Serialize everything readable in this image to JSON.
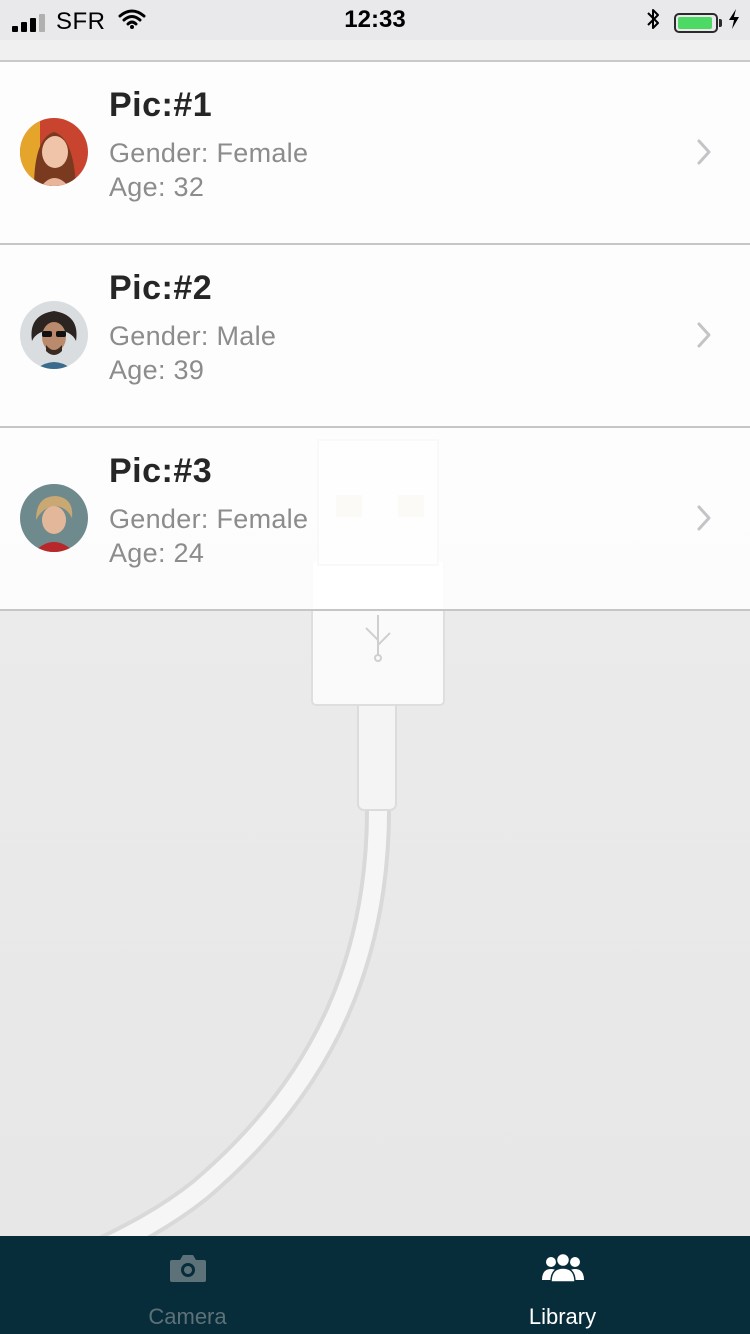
{
  "status_bar": {
    "carrier": "SFR",
    "time": "12:33",
    "battery_level": 0.95,
    "battery_color": "#4cd964"
  },
  "list": {
    "items": [
      {
        "title": "Pic:#1",
        "gender": "Gender: Female",
        "age": "Age: 32",
        "avatar": "avatar-woman-red-hair"
      },
      {
        "title": "Pic:#2",
        "gender": "Gender: Male",
        "age": "Age: 39",
        "avatar": "avatar-man-sunglasses"
      },
      {
        "title": "Pic:#3",
        "gender": "Gender: Female",
        "age": "Age: 24",
        "avatar": "avatar-woman-red-top"
      }
    ]
  },
  "tab_bar": {
    "background": "#072d3b",
    "tabs": [
      {
        "label": "Camera",
        "icon": "camera-icon",
        "selected": false
      },
      {
        "label": "Library",
        "icon": "people-icon",
        "selected": true
      }
    ]
  }
}
